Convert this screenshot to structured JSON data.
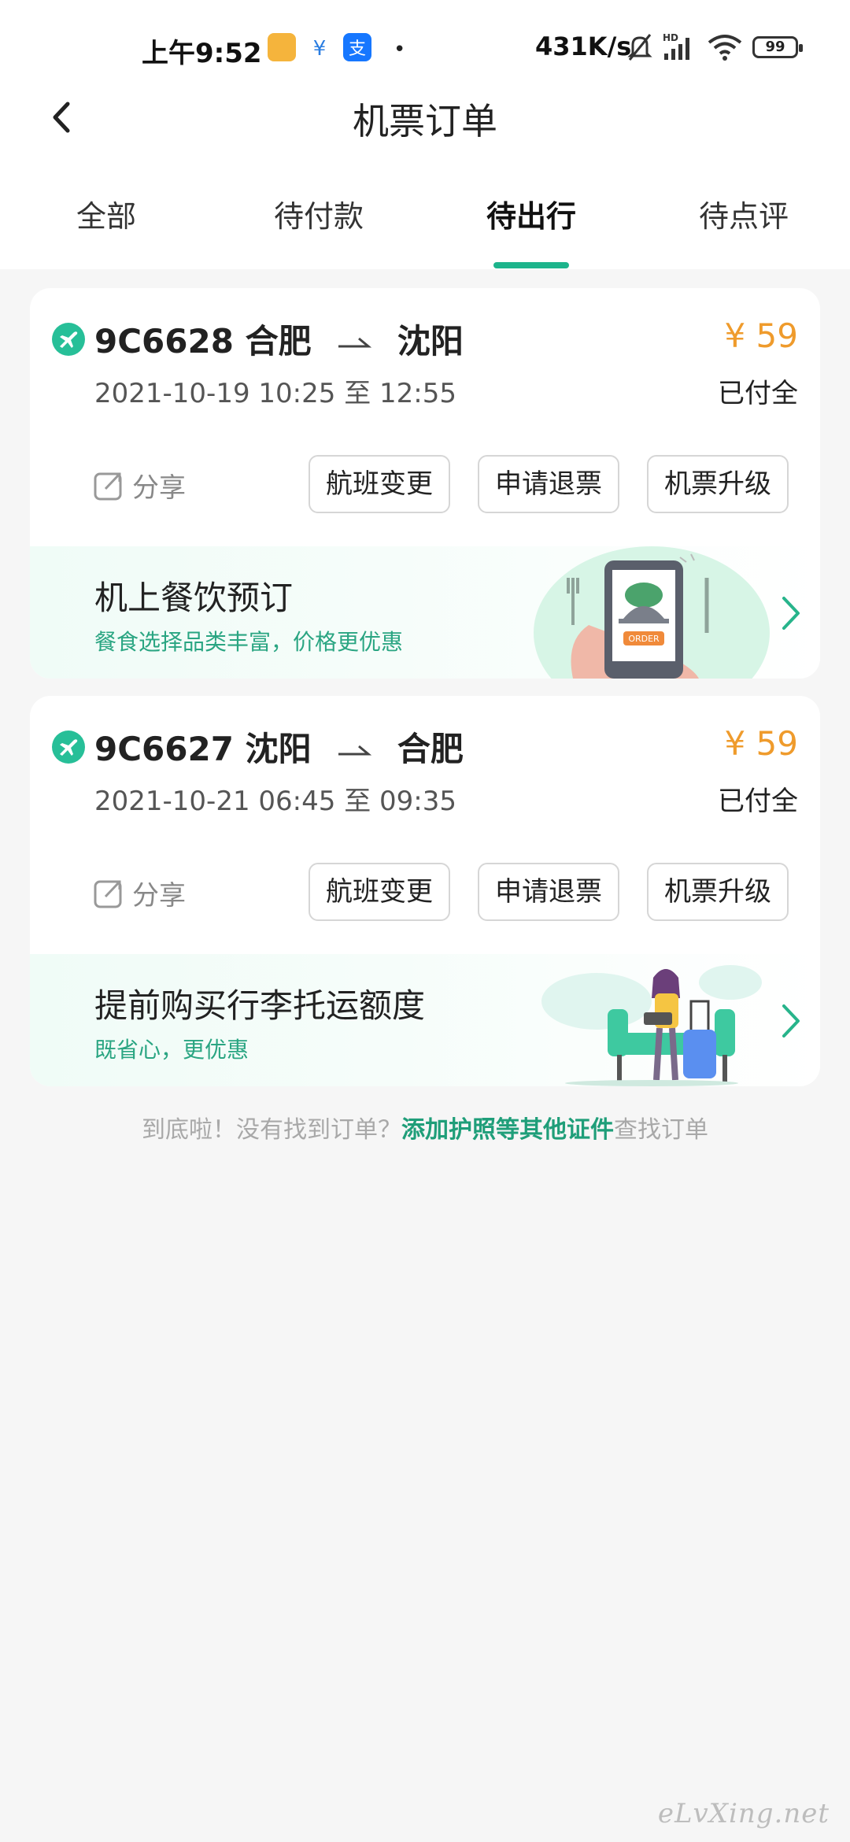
{
  "status_bar": {
    "time": "上午9:52",
    "net_speed": "431K/s",
    "battery": "99"
  },
  "nav": {
    "title": "机票订单"
  },
  "tabs": [
    {
      "label": "全部"
    },
    {
      "label": "待付款"
    },
    {
      "label": "待出行"
    },
    {
      "label": "待点评"
    }
  ],
  "orders": [
    {
      "flight_no": "9C6628",
      "from": "合肥",
      "to": "沈阳",
      "date": "2021-10-19",
      "time_range": "10:25 至 12:55",
      "price": "¥ 59",
      "status": "已付全",
      "share": "分享",
      "buttons": [
        "航班变更",
        "申请退票",
        "机票升级"
      ],
      "promo": {
        "title": "机上餐饮预订",
        "subtitle": "餐食选择品类丰富，价格更优惠",
        "art_label": "ORDER"
      }
    },
    {
      "flight_no": "9C6627",
      "from": "沈阳",
      "to": "合肥",
      "date": "2021-10-21",
      "time_range": "06:45 至 09:35",
      "price": "¥ 59",
      "status": "已付全",
      "share": "分享",
      "buttons": [
        "航班变更",
        "申请退票",
        "机票升级"
      ],
      "promo": {
        "title": "提前购买行李托运额度",
        "subtitle": "既省心，更优惠"
      }
    }
  ],
  "footer": {
    "prefix": "到底啦！没有找到订单？",
    "link": "添加护照等其他证件",
    "suffix": "查找订单"
  },
  "watermark": "eLvXing.net",
  "colors": {
    "accent": "#1db48c",
    "price": "#ef9b2c"
  }
}
